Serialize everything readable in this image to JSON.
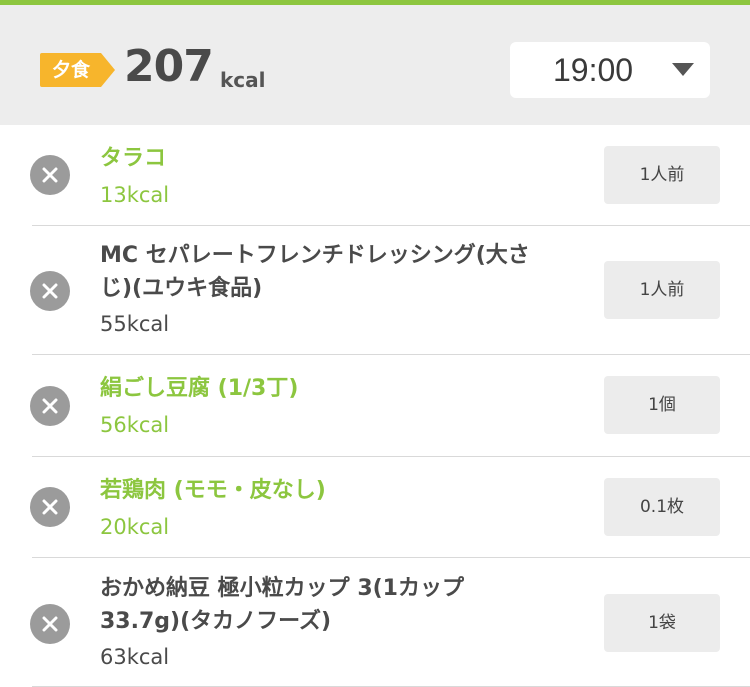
{
  "colors": {
    "accent_bar": "#8dc63f",
    "meal_tag": "#f7b52c",
    "linked_food": "#8cc63f",
    "plain_food": "#4a4a4a",
    "remove_button": "#9b9b9b"
  },
  "header": {
    "meal_label": "夕食",
    "total_calories": "207",
    "calorie_unit": "kcal",
    "time": "19:00"
  },
  "items": [
    {
      "name": "タラコ",
      "calories": "13kcal",
      "portion": "1人前",
      "highlight": true
    },
    {
      "name": "MC セパレートフレンチドレッシング(大さじ)(ユウキ食品)",
      "calories": "55kcal",
      "portion": "1人前",
      "highlight": false
    },
    {
      "name": "絹ごし豆腐 (1/3丁)",
      "calories": "56kcal",
      "portion": "1個",
      "highlight": true
    },
    {
      "name": "若鶏肉 (モモ・皮なし)",
      "calories": "20kcal",
      "portion": "0.1枚",
      "highlight": true
    },
    {
      "name": "おかめ納豆 極小粒カップ 3(1カップ33.7g)(タカノフーズ)",
      "calories": "63kcal",
      "portion": "1袋",
      "highlight": false
    }
  ]
}
